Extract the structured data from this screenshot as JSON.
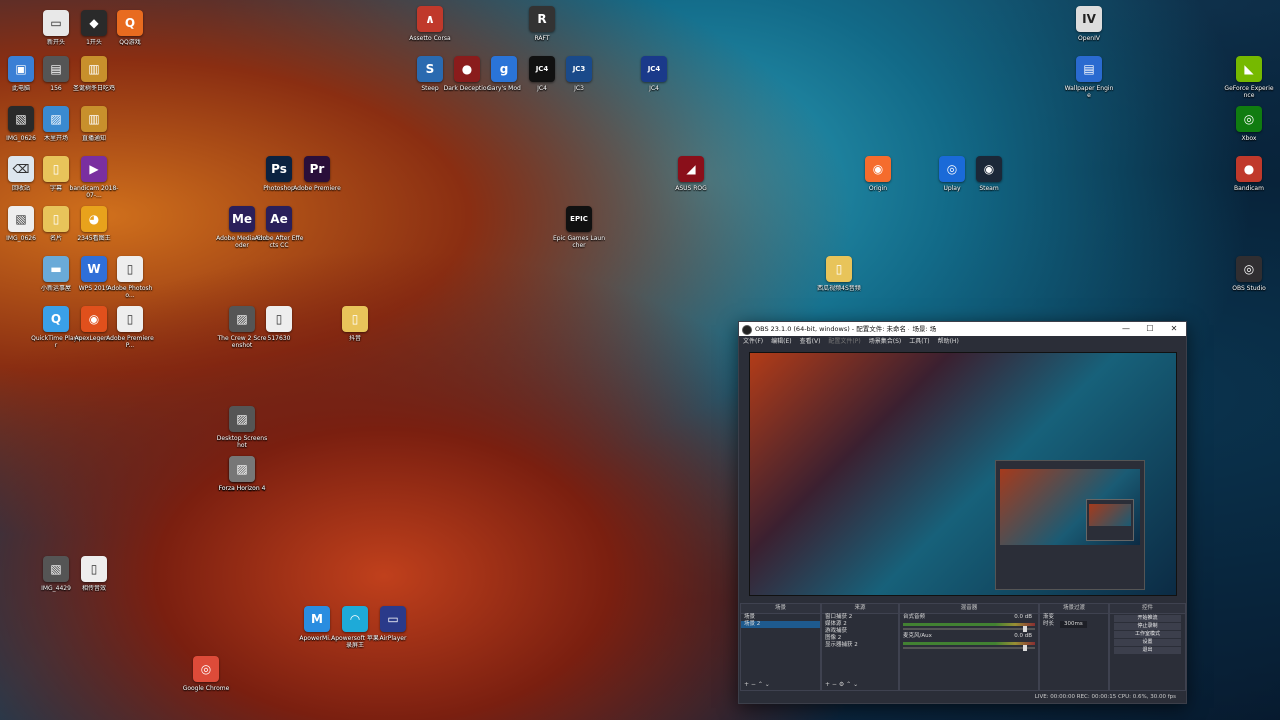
{
  "desktop_icons": [
    {
      "label": "新开头",
      "glyph": "▭",
      "color": "#e8e8e8",
      "fg": "#222"
    },
    {
      "label": "1开头",
      "glyph": "◆",
      "color": "#2a2a2a"
    },
    {
      "label": "QQ游戏",
      "glyph": "Q",
      "color": "#e86b1f"
    },
    {
      "label": "此电脑",
      "glyph": "▣",
      "color": "#3a7fd5"
    },
    {
      "label": "156",
      "glyph": "▤",
      "color": "#555"
    },
    {
      "label": "圣诞树冬日吃鸡",
      "glyph": "▥",
      "color": "#c8902c"
    },
    {
      "label": "IMG_0626",
      "glyph": "▧",
      "color": "#2a2a2a"
    },
    {
      "label": "木里开场",
      "glyph": "▨",
      "color": "#3a8ad0"
    },
    {
      "label": "直播通知",
      "glyph": "▥",
      "color": "#c8902c"
    },
    {
      "label": "回收站",
      "glyph": "⌫",
      "color": "#dde6ee",
      "fg": "#333"
    },
    {
      "label": "字幕",
      "glyph": "▯",
      "color": "#e8c45a"
    },
    {
      "label": "bandicam 2018-07-...",
      "glyph": "▶",
      "color": "#7a2fa0"
    },
    {
      "label": "IMG_0626",
      "glyph": "▧",
      "color": "#eee",
      "fg": "#333"
    },
    {
      "label": "名片",
      "glyph": "▯",
      "color": "#e8c45a"
    },
    {
      "label": "2345看图王",
      "glyph": "◕",
      "color": "#e8a21c"
    },
    {
      "label": "小新运事屋",
      "glyph": "▬",
      "color": "#6aaad8"
    },
    {
      "label": "WPS 2019",
      "glyph": "W",
      "color": "#2f6fd8"
    },
    {
      "label": "Adobe Photosho...",
      "glyph": "▯",
      "color": "#eee",
      "fg": "#333"
    },
    {
      "label": "QuickTime Player",
      "glyph": "Q",
      "color": "#3aa0e8"
    },
    {
      "label": "ApexLegen...",
      "glyph": "◉",
      "color": "#e0501c"
    },
    {
      "label": "Adobe Premiere P...",
      "glyph": "▯",
      "color": "#eee",
      "fg": "#333"
    },
    {
      "label": "IMG_4429",
      "glyph": "▧",
      "color": "#555"
    },
    {
      "label": "相传音效",
      "glyph": "▯",
      "color": "#eee",
      "fg": "#333"
    },
    {
      "label": "Google Chrome",
      "glyph": "◎",
      "color": "#dd4b39"
    },
    {
      "label": "ApowerMi...",
      "glyph": "M",
      "color": "#2a8de0"
    },
    {
      "label": "Apowersoft 苹果录屏王",
      "glyph": "◠",
      "color": "#1eaad8"
    },
    {
      "label": "AirPlayer",
      "glyph": "▭",
      "color": "#2a3a8a"
    },
    {
      "label": "Assetto Corsa",
      "glyph": "∧",
      "color": "#c0392b"
    },
    {
      "label": "Steep",
      "glyph": "S",
      "color": "#2a6ab0"
    },
    {
      "label": "Dark Deception",
      "glyph": "●",
      "color": "#8a1c1c"
    },
    {
      "label": "Gary's Mod",
      "glyph": "g",
      "color": "#2a74d8"
    },
    {
      "label": "RAFT",
      "glyph": "R",
      "color": "#333"
    },
    {
      "label": "JC4",
      "glyph": "JC4",
      "color": "#111"
    },
    {
      "label": "JC3",
      "glyph": "JC3",
      "color": "#1a4a8a"
    },
    {
      "label": "JC4",
      "glyph": "JC4",
      "color": "#1a3a8a"
    },
    {
      "label": "Uplay",
      "glyph": "◎",
      "color": "#1a6ad8"
    },
    {
      "label": "Steam",
      "glyph": "◉",
      "color": "#1b2838"
    },
    {
      "label": "Origin",
      "glyph": "◉",
      "color": "#f56c2d"
    },
    {
      "label": "Wallpaper Engine",
      "glyph": "▤",
      "color": "#2a6ad0"
    },
    {
      "label": "GeForce Experience",
      "glyph": "◣",
      "color": "#76b900"
    },
    {
      "label": "Xbox",
      "glyph": "◎",
      "color": "#107c10"
    },
    {
      "label": "Bandicam",
      "glyph": "●",
      "color": "#c0392b"
    },
    {
      "label": "OBS Studio",
      "glyph": "◎",
      "color": "#302e31"
    },
    {
      "label": "OpenIV",
      "glyph": "IV",
      "color": "#ddd",
      "fg": "#222"
    },
    {
      "label": "Epic Games Launcher",
      "glyph": "EPIC",
      "color": "#111"
    },
    {
      "label": "Adobe Media Encoder",
      "glyph": "Me",
      "color": "#2a1f5a"
    },
    {
      "label": "Adobe After Effects CC",
      "glyph": "Ae",
      "color": "#2a1f5a"
    },
    {
      "label": "Photoshop",
      "glyph": "Ps",
      "color": "#0b2240"
    },
    {
      "label": "Adobe Premiere",
      "glyph": "Pr",
      "color": "#2a0f3a"
    },
    {
      "label": "ASUS ROG",
      "glyph": "◢",
      "color": "#8a0f1a"
    },
    {
      "label": "西瓜视频4S音频",
      "glyph": "▯",
      "color": "#e8c45a"
    },
    {
      "label": "The Crew 2 Screenshot",
      "glyph": "▨",
      "color": "#555"
    },
    {
      "label": "517630",
      "glyph": "▯",
      "color": "#eee",
      "fg": "#333"
    },
    {
      "label": "抖音",
      "glyph": "▯",
      "color": "#e8c45a"
    },
    {
      "label": "Forza Horizon 4",
      "glyph": "▨",
      "color": "#777"
    },
    {
      "label": "Desktop Screenshot",
      "glyph": "▨",
      "color": "#555"
    },
    {
      "label": "Forza Horizon 4",
      "glyph": "▨",
      "color": "#777"
    }
  ],
  "obs": {
    "title": "OBS 23.1.0 (64-bit, windows) - 配置文件: 未命名 - 场景: 场",
    "window_buttons": [
      "—",
      "☐",
      "✕"
    ],
    "menu": [
      "文件(F)",
      "编辑(E)",
      "查看(V)",
      "配置文件(P)",
      "场景集合(S)",
      "工具(T)",
      "帮助(H)"
    ],
    "docks": {
      "scenes": {
        "title": "场景",
        "items": [
          "场景",
          "场景 2"
        ],
        "selected": 1
      },
      "sources": {
        "title": "来源",
        "items": [
          "窗口捕获 2",
          "媒体源 2",
          "游戏捕获",
          "图像 2",
          "显示器捕获 2"
        ]
      },
      "mixer": {
        "title": "混音器",
        "tracks": [
          {
            "name": "台式音频",
            "level": "0.0 dB"
          },
          {
            "name": "麦克风/Aux",
            "level": "0.0 dB"
          }
        ]
      },
      "transitions": {
        "title": "场景过渡",
        "type": "渐变",
        "duration_label": "时长",
        "duration": "300ms"
      },
      "controls": {
        "title": "控件",
        "buttons": [
          "开始推流",
          "停止录制",
          "工作室模式",
          "设置",
          "退出"
        ]
      }
    },
    "status": "LIVE: 00:00:00     REC: 00:00:15     CPU: 0.6%, 30.00 fps"
  }
}
